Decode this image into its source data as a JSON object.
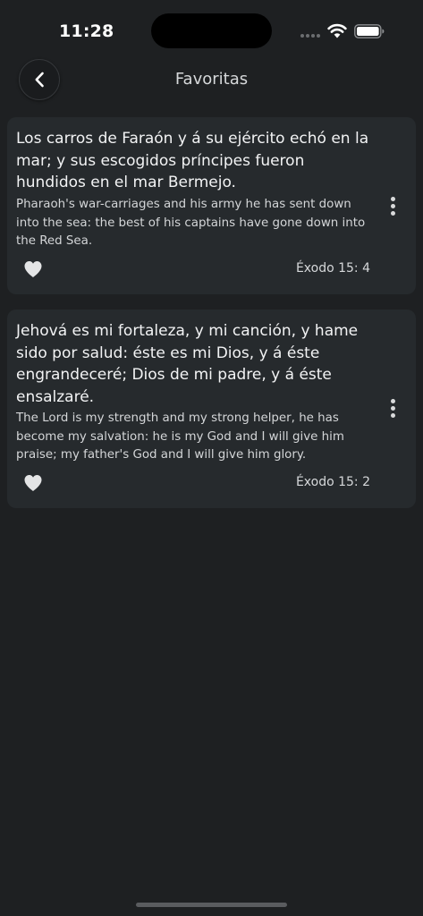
{
  "status_bar": {
    "time": "11:28"
  },
  "header": {
    "title": "Favoritas"
  },
  "favorites": [
    {
      "spanish": "Los carros de Faraón y á su ejército echó en la mar; y sus escogidos príncipes fueron hundidos en el mar Bermejo.",
      "english": "Pharaoh's war-carriages and his army he has sent down into the sea: the best of his captains have gone down into the Red Sea.",
      "reference": "Éxodo 15: 4"
    },
    {
      "spanish": "Jehová es mi fortaleza, y mi canción, y hame sido por salud: éste es mi Dios, y á éste engrandeceré; Dios de mi padre, y á éste ensalzaré.",
      "english": "The Lord is my strength and my strong helper, he has become my salvation: he is my God and I will give him praise; my father's God and I will give him glory.",
      "reference": "Éxodo 15: 2"
    }
  ],
  "icons": {
    "back": "chevron-left-icon",
    "more": "more-vertical-icon",
    "like": "heart-icon"
  },
  "colors": {
    "background": "#1e2022",
    "card": "#262a2d",
    "text": "#f2f3f4"
  }
}
